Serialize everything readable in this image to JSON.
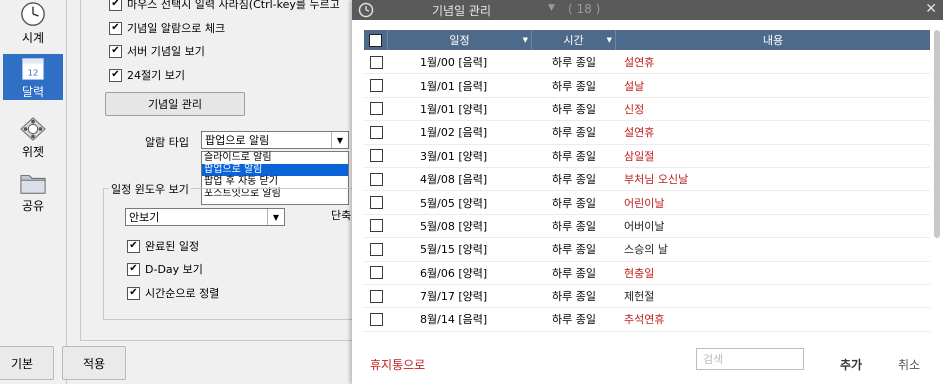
{
  "sidebar": {
    "items": [
      {
        "label": "시계",
        "icon": "clock-icon"
      },
      {
        "label": "달력",
        "icon": "calendar-icon",
        "active": true,
        "icon_text": "12"
      },
      {
        "label": "위젯",
        "icon": "widget-icon"
      },
      {
        "label": "공유",
        "icon": "folder-icon"
      }
    ]
  },
  "settings": {
    "checkboxes": [
      {
        "label": "마우스 선택시 일력 사라짐(Ctrl-key를 누르고",
        "checked": true
      },
      {
        "label": "기념일 알람으로 체크",
        "checked": true
      },
      {
        "label": "서버 기념일 보기",
        "checked": true
      },
      {
        "label": "24절기 보기",
        "checked": true
      }
    ],
    "anniversary_button": "기념일 관리",
    "alarm_type_label": "알람 타입",
    "alarm_type_value": "팝업으로 알림",
    "alarm_options": [
      "슬라이드로 알림",
      "팝업으로 알림",
      "팝업 후 자동 닫기",
      "포스트잇으로 알림"
    ],
    "alarm_selected_index": 1,
    "window_group_label": "일정 윈도우 보기",
    "window_select_value": "안보기",
    "shortcut_label": "단축",
    "window_checkboxes": [
      {
        "label": "완료된 일정",
        "checked": true
      },
      {
        "label": "D-Day 보기",
        "checked": true
      },
      {
        "label": "시간순으로 정렬",
        "checked": true
      }
    ]
  },
  "bottom_buttons": {
    "default": "기본",
    "apply": "적용"
  },
  "dialog": {
    "title": "기념일 관리",
    "count": "( 18 )",
    "columns": {
      "date": "일정",
      "time": "시간",
      "content": "내용"
    },
    "rows": [
      {
        "date": "1월/00 [음력]",
        "time": "하루 종일",
        "title": "설연휴",
        "red": true
      },
      {
        "date": "1월/01 [음력]",
        "time": "하루 종일",
        "title": "설날",
        "red": true
      },
      {
        "date": "1월/01 [양력]",
        "time": "하루 종일",
        "title": "신정",
        "red": true
      },
      {
        "date": "1월/02 [음력]",
        "time": "하루 종일",
        "title": "설연휴",
        "red": true
      },
      {
        "date": "3월/01 [양력]",
        "time": "하루 종일",
        "title": "삼일절",
        "red": true
      },
      {
        "date": "4월/08 [음력]",
        "time": "하루 종일",
        "title": "부처님 오신날",
        "red": true
      },
      {
        "date": "5월/05 [양력]",
        "time": "하루 종일",
        "title": "어린이날",
        "red": true
      },
      {
        "date": "5월/08 [양력]",
        "time": "하루 종일",
        "title": "어버이날",
        "red": false
      },
      {
        "date": "5월/15 [양력]",
        "time": "하루 종일",
        "title": "스승의 날",
        "red": false
      },
      {
        "date": "6월/06 [양력]",
        "time": "하루 종일",
        "title": "현충일",
        "red": true
      },
      {
        "date": "7월/17 [양력]",
        "time": "하루 종일",
        "title": "제헌절",
        "red": false
      },
      {
        "date": "8월/14 [음력]",
        "time": "하루 종일",
        "title": "추석연휴",
        "red": true
      }
    ],
    "trash_link": "휴지통으로",
    "search_placeholder": "검색",
    "add_button": "추가",
    "cancel_button": "취소"
  },
  "colors": {
    "accent": "#2f6fc4",
    "header": "#4d6a8a",
    "holiday": "#c02020",
    "titlebar": "#5a5a5a"
  }
}
